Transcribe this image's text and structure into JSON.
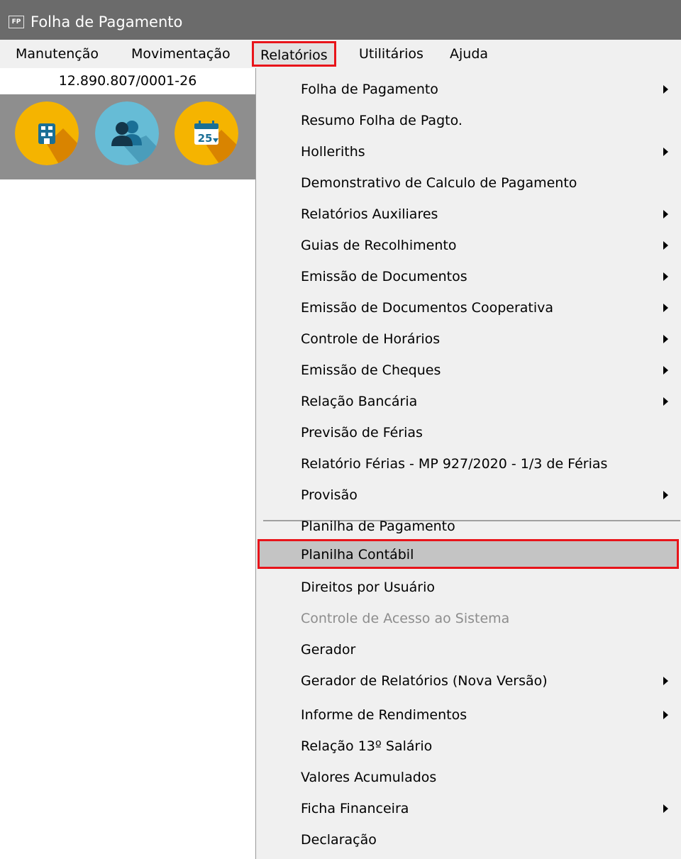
{
  "window": {
    "app_badge": "FP",
    "title": "Folha de Pagamento"
  },
  "menubar": {
    "items": [
      "Manutenção",
      "Movimentação",
      "Relatórios",
      "Utilitários",
      "Ajuda"
    ],
    "active": "Relatórios"
  },
  "company": {
    "cnpj": "12.890.807/0001-26"
  },
  "toolbar": {
    "buttons": [
      {
        "icon": "building-icon",
        "color": "#f5b400"
      },
      {
        "icon": "users-icon",
        "color": "#66bcd6"
      },
      {
        "icon": "calendar-icon",
        "color": "#f5b400",
        "day": "25"
      }
    ]
  },
  "dropdown": {
    "items": [
      {
        "label": "Folha de Pagamento",
        "submenu": true
      },
      {
        "label": "Resumo Folha de Pagto.",
        "submenu": false
      },
      {
        "label": "Holleriths",
        "submenu": true
      },
      {
        "label": "Demonstrativo de Calculo de Pagamento",
        "submenu": false
      },
      {
        "label": "Relatórios Auxiliares",
        "submenu": true
      },
      {
        "label": "Guias de Recolhimento",
        "submenu": true
      },
      {
        "label": "Emissão de Documentos",
        "submenu": true
      },
      {
        "label": "Emissão de Documentos Cooperativa",
        "submenu": true
      },
      {
        "label": "Controle de Horários",
        "submenu": true
      },
      {
        "label": "Emissão de Cheques",
        "submenu": true
      },
      {
        "label": "Relação Bancária",
        "submenu": true
      },
      {
        "label": "Previsão de Férias",
        "submenu": false
      },
      {
        "label": "Relatório Férias - MP 927/2020 - 1/3 de Férias",
        "submenu": false
      },
      {
        "label": "Provisão",
        "submenu": true
      },
      {
        "label": "Planilha de Pagamento",
        "submenu": false
      },
      {
        "label": "Planilha Contábil",
        "submenu": false,
        "highlighted": true
      },
      {
        "label": "Direitos por Usuário",
        "submenu": false
      },
      {
        "label": "Controle de Acesso ao Sistema",
        "submenu": false,
        "disabled": true
      },
      {
        "label": "Gerador",
        "submenu": false
      },
      {
        "label": "Gerador de Relatórios (Nova Versão)",
        "submenu": true
      },
      {
        "label": "Informe de Rendimentos",
        "submenu": true
      },
      {
        "label": "Relação 13º Salário",
        "submenu": false
      },
      {
        "label": "Valores Acumulados",
        "submenu": false
      },
      {
        "label": "Ficha Financeira",
        "submenu": true
      },
      {
        "label": "Declaração",
        "submenu": false
      }
    ]
  },
  "colors": {
    "highlight_border": "#e8141a",
    "titlebar": "#6b6b6b",
    "menu_bg": "#f0f0f0"
  }
}
